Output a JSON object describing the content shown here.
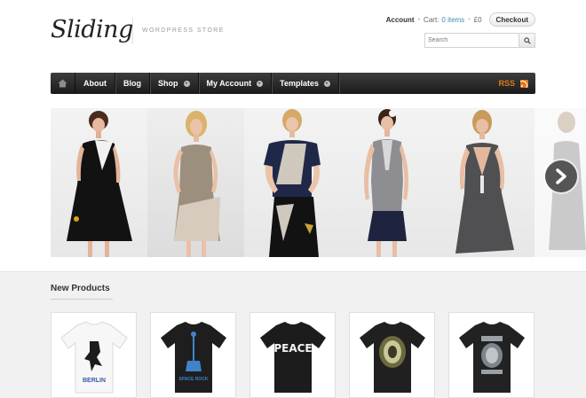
{
  "header": {
    "logo_text": "Sliding",
    "tagline": "WORDPRESS STORE"
  },
  "topbar": {
    "account_label": "Account",
    "cart_label": "Cart:",
    "cart_count": "0 items",
    "cart_total": "£0",
    "checkout_label": "Checkout"
  },
  "search": {
    "placeholder": "Search",
    "value": "Search"
  },
  "nav": {
    "items": [
      {
        "label": "About",
        "has_dropdown": false
      },
      {
        "label": "Blog",
        "has_dropdown": false
      },
      {
        "label": "Shop",
        "has_dropdown": true
      },
      {
        "label": "My Account",
        "has_dropdown": true
      },
      {
        "label": "Templates",
        "has_dropdown": true
      }
    ],
    "rss_label": "RSS",
    "colors": {
      "bar": "#2a2a2a",
      "rss": "#e2771b"
    }
  },
  "slider": {
    "slides": [
      {
        "dress": "black-white-dress"
      },
      {
        "dress": "beige-dress"
      },
      {
        "dress": "navy-colorblock-dress"
      },
      {
        "dress": "grey-navy-dress"
      },
      {
        "dress": "grey-draped-dress"
      },
      {
        "dress": "partial-next-slide"
      }
    ],
    "next_icon": "chevron-right-icon"
  },
  "products_section": {
    "title": "New Products",
    "products": [
      {
        "print": "BERLIN",
        "shirt_color": "#ffffff"
      },
      {
        "print": "SPACE ROCK",
        "shirt_color": "#1e1e1e"
      },
      {
        "print": "PEACE",
        "shirt_color": "#1c1c1c"
      },
      {
        "print": "",
        "shirt_color": "#202020"
      },
      {
        "print": "",
        "shirt_color": "#222222"
      }
    ]
  }
}
